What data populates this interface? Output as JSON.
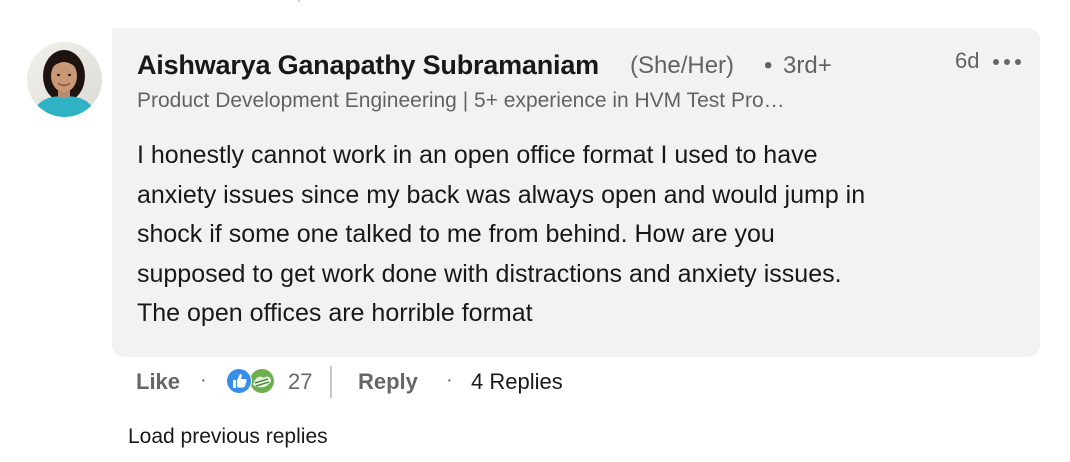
{
  "comment": {
    "author_name": "Aishwarya Ganapathy Subramaniam",
    "pronouns": "(She/Her)",
    "separator": "•",
    "connection_degree": "3rd+",
    "timestamp": "6d",
    "headline": "Product Development Engineering | 5+ experience in HVM Test Pro…",
    "body_lines": [
      "I honestly cannot work in an open office format I used to have",
      "anxiety issues since my back was always open and would jump in",
      "shock if some one talked to me from behind. How are you",
      "supposed to get work done with distractions and anxiety issues.",
      "The open offices are horrible format"
    ],
    "avatar_icon": "profile-photo",
    "more_icon": "ellipsis-icon"
  },
  "actions": {
    "like_label": "Like",
    "dot_separator": "·",
    "reaction_icons": [
      "like-reaction-icon",
      "support-reaction-icon"
    ],
    "reaction_count": "27",
    "reply_label": "Reply",
    "replies_label": "4 Replies"
  },
  "footer": {
    "load_previous_label": "Load previous replies"
  },
  "colors": {
    "bubble_bg": "#f2f2f2",
    "like_reaction_blue": "#378fe9",
    "support_reaction_green": "#6dae4f",
    "muted_text": "#666666"
  }
}
